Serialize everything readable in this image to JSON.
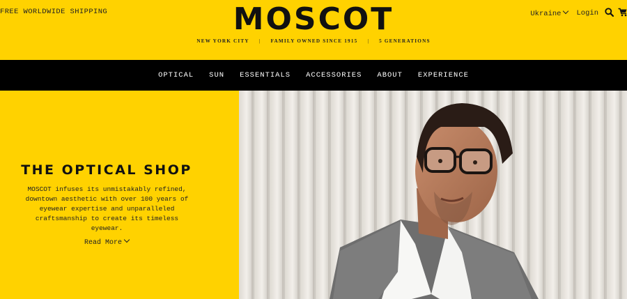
{
  "header": {
    "shipping": "FREE WORLDWIDE SHIPPING",
    "logo": "MOSCOT",
    "tagline": [
      "NEW YORK CITY",
      "FAMILY OWNED SINCE 1915",
      "5 GENERATIONS"
    ],
    "tagline_separator": "|",
    "country": "Ukraine",
    "login": "Login",
    "icons": [
      "search-icon",
      "cart-icon"
    ]
  },
  "nav": {
    "items": [
      "OPTICAL",
      "SUN",
      "ESSENTIALS",
      "ACCESSORIES",
      "ABOUT",
      "EXPERIENCE"
    ]
  },
  "hero": {
    "title": "THE OPTICAL SHOP",
    "description": "MOSCOT infuses its unmistakably refined, downtown aesthetic with over 100 years of eyewear expertise and unparalleled craftsmanship to create its timeless eyewear.",
    "read_more": "Read More"
  },
  "colors": {
    "brand_yellow": "#ffd200",
    "nav_bg": "#000000",
    "text": "#111111"
  }
}
